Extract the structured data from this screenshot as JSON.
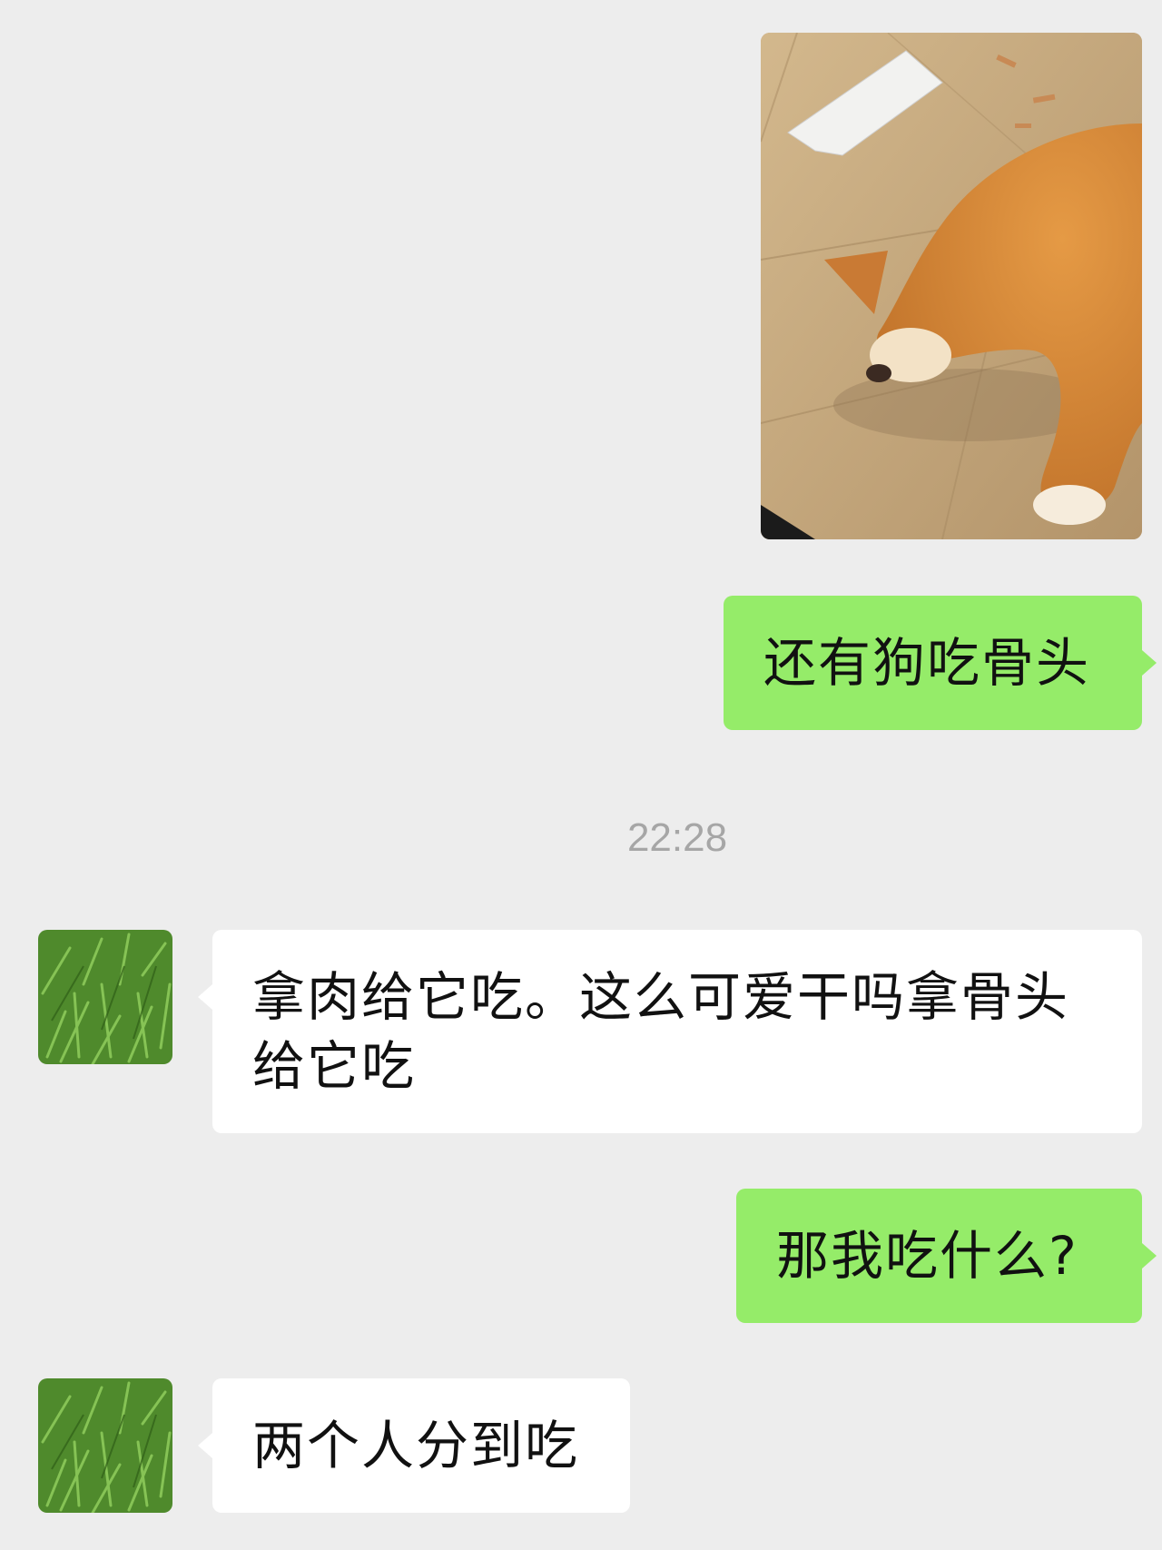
{
  "chat": {
    "messages": [
      {
        "direction": "sent",
        "type": "image",
        "image_description_icon": "shiba-dog-photo"
      },
      {
        "direction": "sent",
        "type": "text",
        "text": "还有狗吃骨头"
      },
      {
        "type": "timestamp",
        "text": "22:28"
      },
      {
        "direction": "received",
        "type": "text",
        "line1": "拿肉给它吃。这么可爱干吗拿骨头",
        "line2": "给它吃"
      },
      {
        "direction": "sent",
        "type": "text",
        "text": "那我吃什么?"
      },
      {
        "direction": "received",
        "type": "text",
        "text": "两个人分到吃"
      }
    ],
    "contact_avatar_icon": "grass-avatar"
  },
  "colors": {
    "background": "#ededed",
    "sent_bubble": "#95ec69",
    "received_bubble": "#ffffff",
    "timestamp": "#a6a6a6"
  }
}
